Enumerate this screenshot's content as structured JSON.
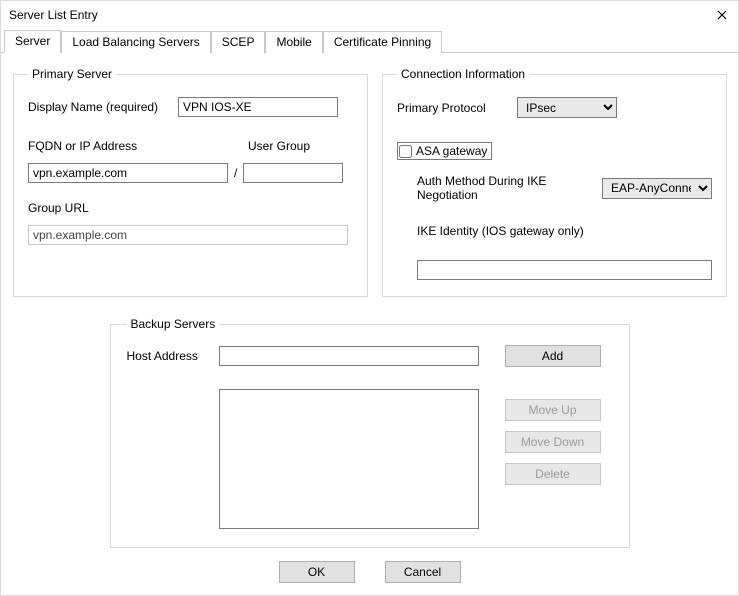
{
  "window": {
    "title": "Server List Entry"
  },
  "tabs": {
    "server": "Server",
    "load_balancing": "Load Balancing Servers",
    "scep": "SCEP",
    "mobile": "Mobile",
    "cert_pinning": "Certificate Pinning"
  },
  "primary_server": {
    "legend": "Primary Server",
    "display_name_label": "Display Name (required)",
    "display_name_value": "VPN IOS-XE",
    "fqdn_label": "FQDN or IP Address",
    "user_group_label": "User Group",
    "fqdn_value": "vpn.example.com",
    "slash": "/",
    "user_group_value": "",
    "group_url_label": "Group URL",
    "group_url_value": "vpn.example.com"
  },
  "connection_info": {
    "legend": "Connection Information",
    "primary_protocol_label": "Primary Protocol",
    "primary_protocol_value": "IPsec",
    "asa_gateway_label": "ASA gateway",
    "asa_gateway_checked": false,
    "auth_method_label": "Auth Method During IKE Negotiation",
    "auth_method_value": "EAP-AnyConnect",
    "ike_identity_label": "IKE Identity (IOS gateway only)",
    "ike_identity_value": ""
  },
  "backup_servers": {
    "legend": "Backup Servers",
    "host_address_label": "Host Address",
    "host_address_value": "",
    "add_label": "Add",
    "move_up_label": "Move Up",
    "move_down_label": "Move Down",
    "delete_label": "Delete",
    "items": []
  },
  "footer": {
    "ok_label": "OK",
    "cancel_label": "Cancel"
  }
}
